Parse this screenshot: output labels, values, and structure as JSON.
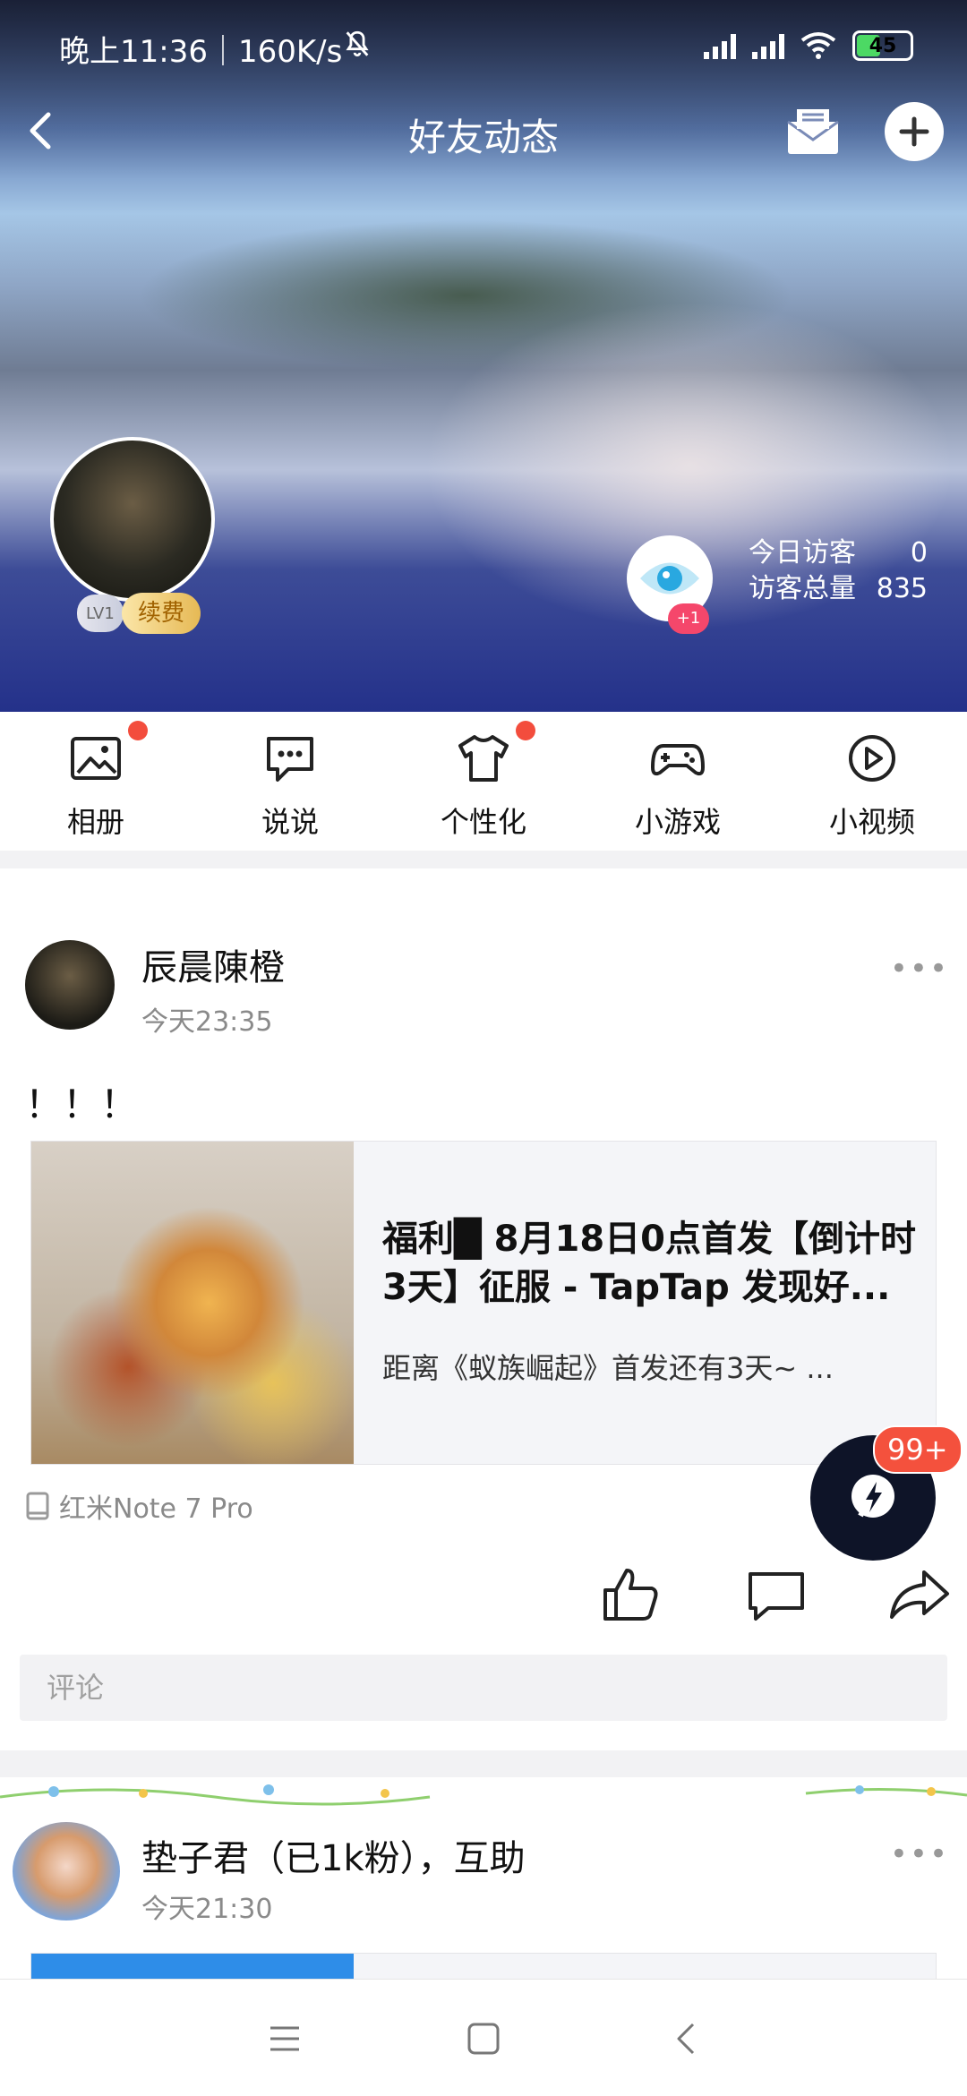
{
  "status_bar": {
    "time_speed": "晚上11:36｜160K/s",
    "battery": "45"
  },
  "header": {
    "title": "好友动态"
  },
  "profile": {
    "level": "LV1",
    "renew_label": "续费",
    "visit_badge": "+1",
    "today_visitors_label": "今日访客",
    "today_visitors_value": "0",
    "total_visitors_label": "访客总量",
    "total_visitors_value": "835"
  },
  "toolbar": {
    "items": [
      {
        "label": "相册",
        "icon": "photo-album-icon",
        "dot": true
      },
      {
        "label": "说说",
        "icon": "message-bubble-icon",
        "dot": false
      },
      {
        "label": "个性化",
        "icon": "tshirt-icon",
        "dot": true
      },
      {
        "label": "小游戏",
        "icon": "gamepad-icon",
        "dot": false
      },
      {
        "label": "小视频",
        "icon": "play-circle-icon",
        "dot": false
      }
    ]
  },
  "post1": {
    "author": "辰晨陳橙",
    "time": "今天23:35",
    "text": "！！！",
    "card_title": "福利█ 8月18日0点首发【倒计时3天】征服 - TapTap 发现好...",
    "card_desc": "距离《蚁族崛起》首发还有3天~ ...",
    "device": "红米Note 7 Pro",
    "comment_placeholder": "评论"
  },
  "post2": {
    "author": "垫子君（已1k粉），互助",
    "time": "今天21:30"
  },
  "fab": {
    "badge": "99+"
  },
  "colors": {
    "accent_red": "#f34d3d",
    "fab_dark": "#0e1428",
    "eye_blue": "#29a8e0"
  }
}
